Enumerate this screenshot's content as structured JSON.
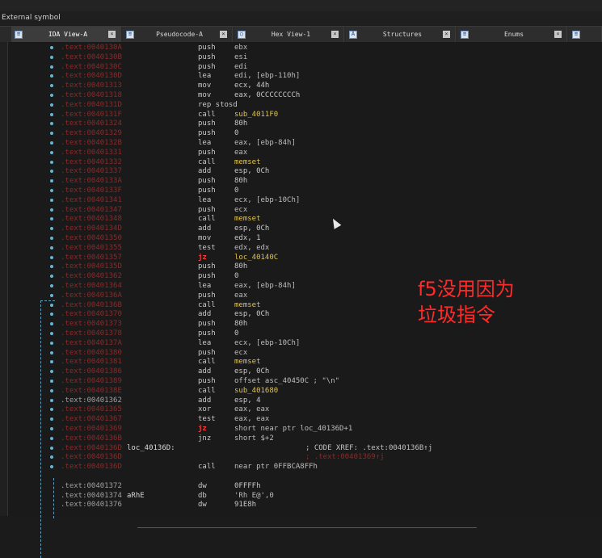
{
  "status_text": "External symbol",
  "tabs": [
    {
      "label": "IDA View-A",
      "icon": "doc-icon",
      "active": true
    },
    {
      "label": "Pseudocode-A",
      "icon": "doc-icon",
      "active": false
    },
    {
      "label": "Hex View-1",
      "icon": "hex-icon",
      "active": false
    },
    {
      "label": "Structures",
      "icon": "struct-icon",
      "active": false
    },
    {
      "label": "Enums",
      "icon": "enum-icon",
      "active": false
    }
  ],
  "annotation": {
    "line1": "f5没用因为",
    "line2": "垃圾指令"
  },
  "code_lines": [
    {
      "addr": ".text:0040130A",
      "mn": "push",
      "op": "ebx"
    },
    {
      "addr": ".text:0040130B",
      "mn": "push",
      "op": "esi"
    },
    {
      "addr": ".text:0040130C",
      "mn": "push",
      "op": "edi"
    },
    {
      "addr": ".text:0040130D",
      "mn": "lea",
      "op": "edi, [ebp-110h]"
    },
    {
      "addr": ".text:00401313",
      "mn": "mov",
      "op": "ecx, 44h"
    },
    {
      "addr": ".text:00401318",
      "mn": "mov",
      "op": "eax, 0CCCCCCCCh"
    },
    {
      "addr": ".text:0040131D",
      "mn": "rep stosd",
      "op": ""
    },
    {
      "addr": ".text:0040131F",
      "mn": "call",
      "op": "sub_4011F0"
    },
    {
      "addr": ".text:00401324",
      "mn": "push",
      "op": "80h"
    },
    {
      "addr": ".text:00401329",
      "mn": "push",
      "op": "0"
    },
    {
      "addr": ".text:0040132B",
      "mn": "lea",
      "op": "eax, [ebp-84h]"
    },
    {
      "addr": ".text:00401331",
      "mn": "push",
      "op": "eax"
    },
    {
      "addr": ".text:00401332",
      "mn": "call",
      "op": "memset"
    },
    {
      "addr": ".text:00401337",
      "mn": "add",
      "op": "esp, 0Ch"
    },
    {
      "addr": ".text:0040133A",
      "mn": "push",
      "op": "80h"
    },
    {
      "addr": ".text:0040133F",
      "mn": "push",
      "op": "0"
    },
    {
      "addr": ".text:00401341",
      "mn": "lea",
      "op": "ecx, [ebp-10Ch]"
    },
    {
      "addr": ".text:00401347",
      "mn": "push",
      "op": "ecx"
    },
    {
      "addr": ".text:00401348",
      "mn": "call",
      "op": "memset"
    },
    {
      "addr": ".text:0040134D",
      "mn": "add",
      "op": "esp, 0Ch"
    },
    {
      "addr": ".text:00401350",
      "mn": "mov",
      "op": "edx, 1"
    },
    {
      "addr": ".text:00401355",
      "mn": "test",
      "op": "edx, edx"
    },
    {
      "addr": ".text:00401357",
      "mn": "jz",
      "op": "loc_40140C"
    },
    {
      "addr": ".text:0040135D",
      "mn": "push",
      "op": "80h"
    },
    {
      "addr": ".text:00401362",
      "mn": "push",
      "op": "0"
    },
    {
      "addr": ".text:00401364",
      "mn": "lea",
      "op": "eax, [ebp-84h]"
    },
    {
      "addr": ".text:0040136A",
      "mn": "push",
      "op": "eax"
    },
    {
      "addr": ".text:0040136B",
      "mn": "call",
      "op": "memset"
    },
    {
      "addr": ".text:00401370",
      "mn": "add",
      "op": "esp, 0Ch"
    },
    {
      "addr": ".text:00401373",
      "mn": "push",
      "op": "80h"
    },
    {
      "addr": ".text:00401378",
      "mn": "push",
      "op": "0"
    },
    {
      "addr": ".text:0040137A",
      "mn": "lea",
      "op": "ecx, [ebp-10Ch]"
    },
    {
      "addr": ".text:00401380",
      "mn": "push",
      "op": "ecx"
    },
    {
      "addr": ".text:00401381",
      "mn": "call",
      "op": "memset"
    },
    {
      "addr": ".text:00401386",
      "mn": "add",
      "op": "esp, 0Ch"
    },
    {
      "addr": ".text:00401389",
      "mn": "push",
      "op": "offset asc_40450C ; \"\\n\""
    },
    {
      "addr": ".text:0040138E",
      "mn": "call",
      "op": "sub_401680"
    },
    {
      "addr": ".text:00401362",
      "mn": "add",
      "op": "esp, 4",
      "plain": true
    },
    {
      "addr": ".text:00401365",
      "mn": "xor",
      "op": "eax, eax"
    },
    {
      "addr": ".text:00401367",
      "mn": "test",
      "op": "eax, eax"
    },
    {
      "addr": ".text:00401369",
      "mn": "jz",
      "op": "short near ptr loc_40136D+1"
    },
    {
      "addr": ".text:0040136B",
      "mn": "jnz",
      "op": "short $+2"
    },
    {
      "addr": ".text:0040136D",
      "label": "loc_40136D:",
      "mn": "",
      "op": "",
      "comment": "; CODE XREF: .text:0040136B↑j"
    },
    {
      "addr": ".text:0040136D",
      "mn": "",
      "op": "",
      "comment2": "; .text:00401369↑j"
    },
    {
      "addr": ".text:0040136D",
      "mn": "call",
      "op": "near ptr 0FFBCA8FFh"
    },
    {
      "addr": "",
      "mn": "",
      "op": ""
    },
    {
      "addr": ".text:00401372",
      "mn": "dw",
      "op": "0FFFFh",
      "plain": true
    },
    {
      "addr": ".text:00401374",
      "label": "aRhE",
      "mn": "db",
      "op": "'Rh E@',0",
      "plain": true
    },
    {
      "addr": ".text:00401376",
      "mn": "dw",
      "op": "91E8h",
      "plain": true
    }
  ]
}
